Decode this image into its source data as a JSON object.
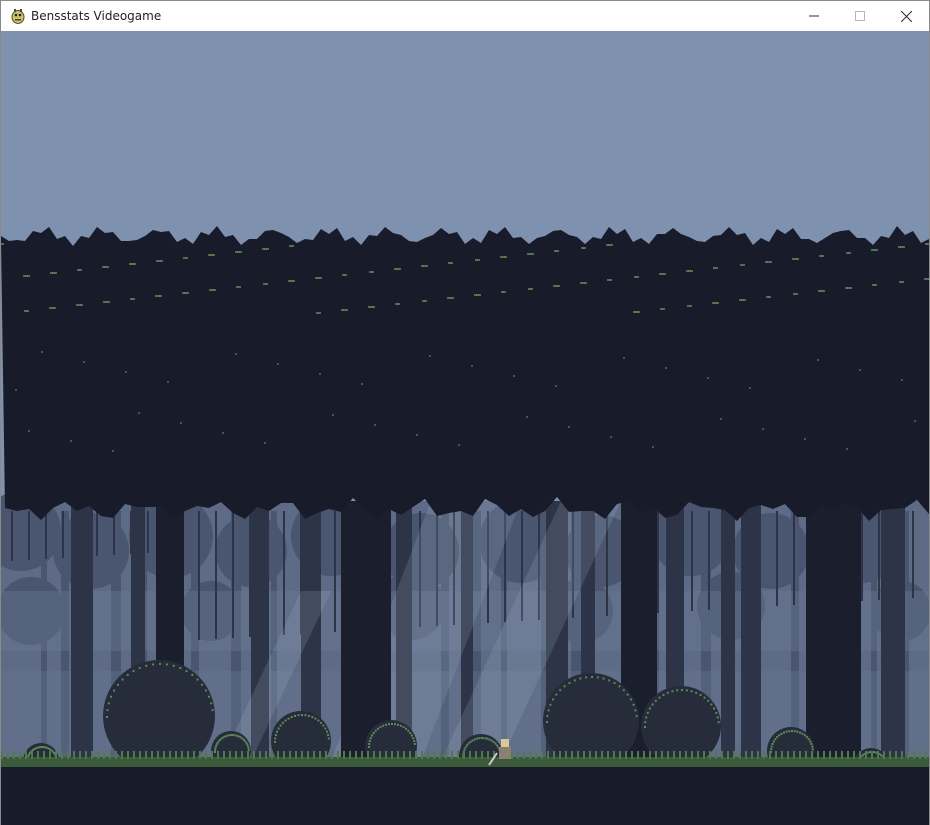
{
  "window": {
    "title": "Bensstats Videogame",
    "icon": "pygame-snake-icon",
    "controls": [
      "minimize-icon",
      "maximize-icon",
      "close-icon"
    ]
  },
  "game": {
    "scene": "pixel-art forest at dusk",
    "colors": {
      "sky": "#7e91ae",
      "canopy": "#181b2a",
      "canopy_highlight": "#5f8a58",
      "far_trees": "#4a5670",
      "mid_trees": "#2e3447",
      "near_trunks": "#1b1e2d",
      "mist": "#6c7b96",
      "bush": "#262c3a",
      "bush_dots": "#5c8a5a",
      "grass": "#3a5a3a",
      "ground": "#181b2a"
    },
    "player": "knight-sprite"
  }
}
